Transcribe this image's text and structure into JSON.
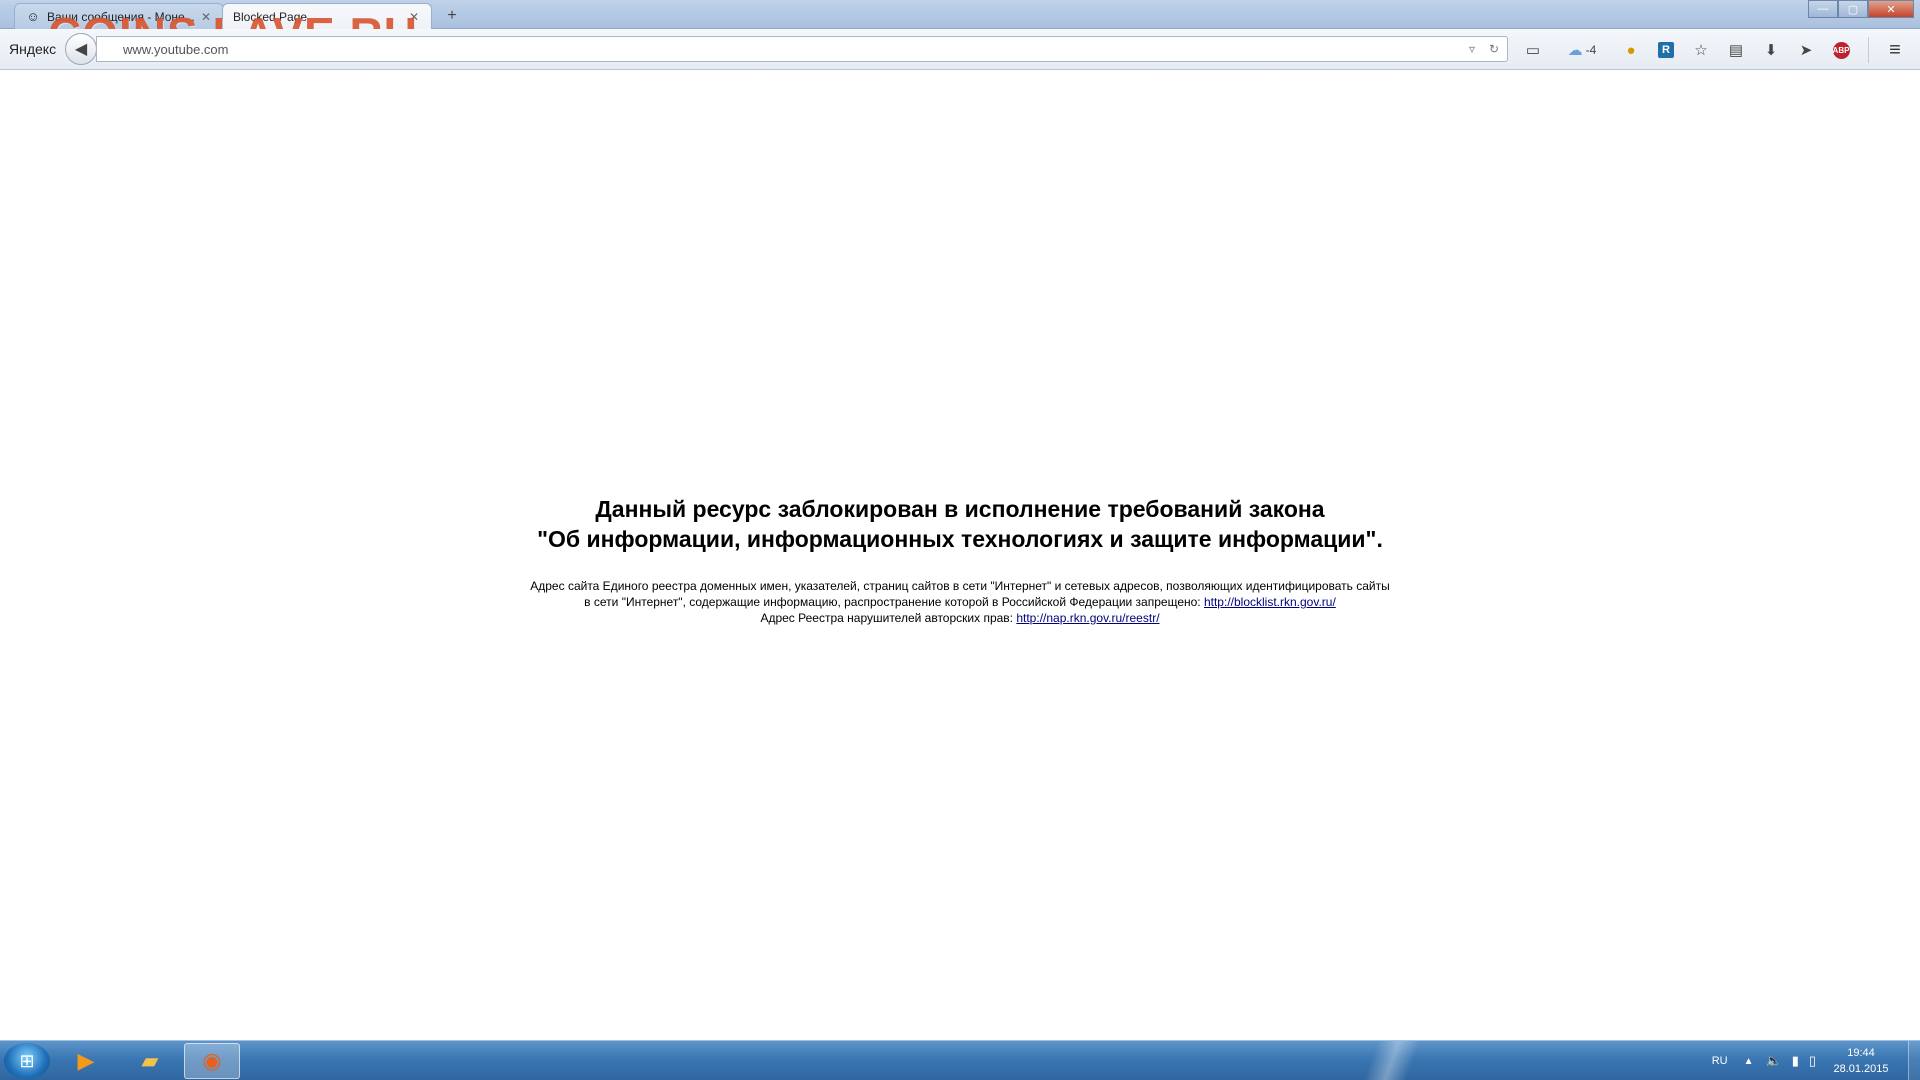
{
  "browser": {
    "tabs": [
      {
        "title": "Ваши сообщения - Моне...",
        "favicon": "smiley-icon",
        "active": false
      },
      {
        "title": "Blocked Page",
        "favicon": "",
        "active": true
      }
    ],
    "new_tab_label": "+",
    "window_controls": {
      "minimize": "—",
      "maximize": "▢",
      "close": "✕"
    },
    "watermark": "COINS.LAVE.RU"
  },
  "navbar": {
    "yandex_label": "Яндекс",
    "url": "www.youtube.com",
    "weather_value": "-4",
    "icons": [
      "screenshot-icon",
      "weather-cloud-icon",
      "coin-icon",
      "r-box-icon",
      "bookmark-star-icon",
      "clipboard-icon",
      "download-icon",
      "send-icon",
      "adblock-icon",
      "menu-icon"
    ]
  },
  "page": {
    "heading_line1": "Данный ресурс заблокирован в исполнение требований закона",
    "heading_line2": "\"Об информации, информационных технологиях и защите информации\".",
    "info_line1": "Адрес сайта Единого реестра доменных имен, указателей, страниц сайтов в сети \"Интернет\" и сетевых адресов, позволяющих идентифицировать сайты",
    "info_line2_prefix": "в сети \"Интернет\", содержащие информацию, распространение которой в Российской Федерации запрещено:",
    "blocklist_link": "http://blocklist.rkn.gov.ru/",
    "info_line3_prefix": "Адрес Реестра нарушителей авторских прав:",
    "nap_link": "http://nap.rkn.gov.ru/reestr/"
  },
  "taskbar": {
    "apps": [
      "media-player-icon",
      "file-explorer-icon",
      "firefox-icon"
    ],
    "language": "RU",
    "time": "19:44",
    "date": "28.01.2015"
  }
}
